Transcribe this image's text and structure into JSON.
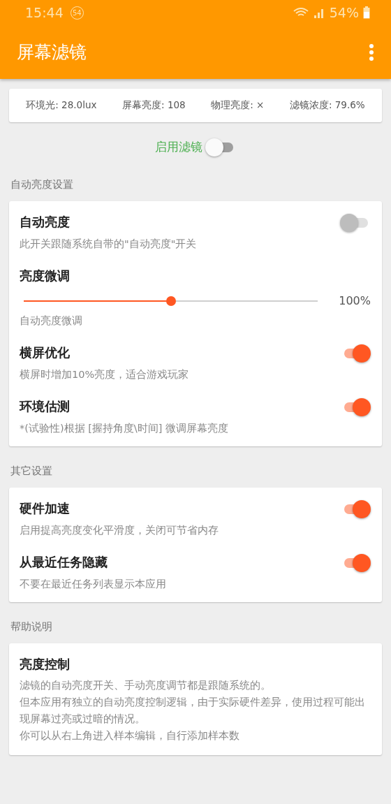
{
  "status_bar": {
    "time": "15:44",
    "notification_count": "54",
    "battery": "54%"
  },
  "app_bar": {
    "title": "屏幕滤镜"
  },
  "info": [
    "环境光: 28.0lux",
    "屏幕亮度: 108",
    "物理亮度: ×",
    "滤镜浓度: 79.6%"
  ],
  "enable": {
    "label": "启用滤镜",
    "on": false
  },
  "sections": [
    {
      "title": "自动亮度设置",
      "items": [
        {
          "kind": "switch",
          "title": "自动亮度",
          "summary": "此开关跟随系统自带的\"自动亮度\"开关",
          "on": false
        },
        {
          "kind": "slider",
          "title": "亮度微调",
          "summary": "自动亮度微调",
          "level": 0.5,
          "reading": "100%"
        },
        {
          "kind": "switch",
          "title": "横屏优化",
          "summary": "横屏时增加10%亮度，适合游戏玩家",
          "on": true
        },
        {
          "kind": "switch",
          "title": "环境估测",
          "summary": "*(试验性)根据 [握持角度\\时间] 微调屏幕亮度",
          "on": true
        }
      ]
    },
    {
      "title": "其它设置",
      "items": [
        {
          "kind": "switch",
          "title": "硬件加速",
          "summary": "启用提高亮度变化平滑度，关闭可节省内存",
          "on": true
        },
        {
          "kind": "switch",
          "title": "从最近任务隐藏",
          "summary": "不要在最近任务列表显示本应用",
          "on": true
        }
      ]
    },
    {
      "title": "帮助说明",
      "items": [
        {
          "kind": "text",
          "title": "亮度控制",
          "lines": [
            "滤镜的自动亮度开关、手动亮度调节都是跟随系统的。",
            "但本应用有独立的自动亮度控制逻辑，由于实际硬件差异，使用过程可能出现屏幕过亮或过暗的情况。",
            "你可以从右上角进入样本编辑，自行添加样本数"
          ]
        }
      ]
    }
  ]
}
